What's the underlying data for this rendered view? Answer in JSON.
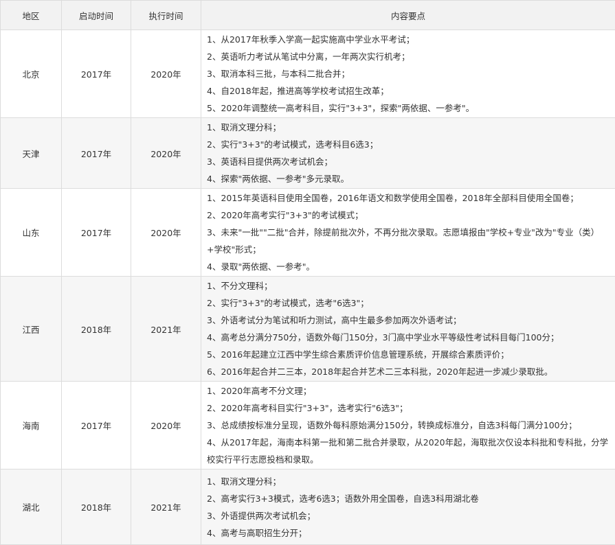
{
  "headers": {
    "region": "地区",
    "start": "启动时间",
    "exec": "执行时间",
    "content": "内容要点"
  },
  "rows": [
    {
      "region": "北京",
      "start": "2017年",
      "exec": "2020年",
      "lines": [
        "1、从2017年秋季入学高一起实施高中学业水平考试；",
        "2、英语听力考试从笔试中分离，一年两次实行机考；",
        "3、取消本科三批，与本科二批合并；",
        "4、自2018年起，推进高等学校考试招生改革；",
        "5、2020年调整统一高考科目，实行\"3+3\"，探索\"两依据、一参考\"。"
      ]
    },
    {
      "region": "天津",
      "start": "2017年",
      "exec": "2020年",
      "lines": [
        "1、取消文理分科；",
        "2、实行\"3+3\"的考试模式，选考科目6选3；",
        "3、英语科目提供两次考试机会；",
        "4、探索\"两依据、一参考\"多元录取。"
      ]
    },
    {
      "region": "山东",
      "start": "2017年",
      "exec": "2020年",
      "lines": [
        "1、2015年英语科目使用全国卷，2016年语文和数学使用全国卷，2018年全部科目使用全国卷；",
        "2、2020年高考实行\"3+3\"的考试模式；",
        "3、未来\"一批\"\"二批\"合并，除提前批次外，不再分批次录取。志愿填报由\"学校+专业\"改为\"专业（类）+学校\"形式；",
        "4、录取\"两依据、一参考\"。"
      ]
    },
    {
      "region": "江西",
      "start": "2018年",
      "exec": "2021年",
      "lines": [
        "1、不分文理科；",
        "2、实行\"3+3\"的考试模式，选考\"6选3\"；",
        "3、外语考试分为笔试和听力测试，高中生最多参加两次外语考试；",
        "4、高考总分满分750分，语数外每门150分，3门高中学业水平等级性考试科目每门100分；",
        "5、2016年起建立江西中学生综合素质评价信息管理系统，开展综合素质评价；",
        "6、2016年起合并二三本，2018年起合并艺术二三本科批，2020年起进一步减少录取批。"
      ]
    },
    {
      "region": "海南",
      "start": "2017年",
      "exec": "2020年",
      "lines": [
        "1、2020年高考不分文理；",
        "2、2020年高考科目实行\"3+3\"，选考实行\"6选3\"；",
        "3、总成绩按标准分呈现，语数外每科原始满分150分，转换成标准分，自选3科每门满分100分；",
        "4、从2017年起，海南本科第一批和第二批合并录取，从2020年起，海取批次仅设本科批和专科批，分学校实行平行志愿投档和录取。"
      ]
    },
    {
      "region": "湖北",
      "start": "2018年",
      "exec": "2021年",
      "lines": [
        "1、取消文理分科；",
        "2、高考实行3+3模式，选考6选3；语数外用全国卷，自选3科用湖北卷",
        "3、外语提供两次考试机会；",
        "4、高考与高职招生分开；"
      ]
    }
  ]
}
